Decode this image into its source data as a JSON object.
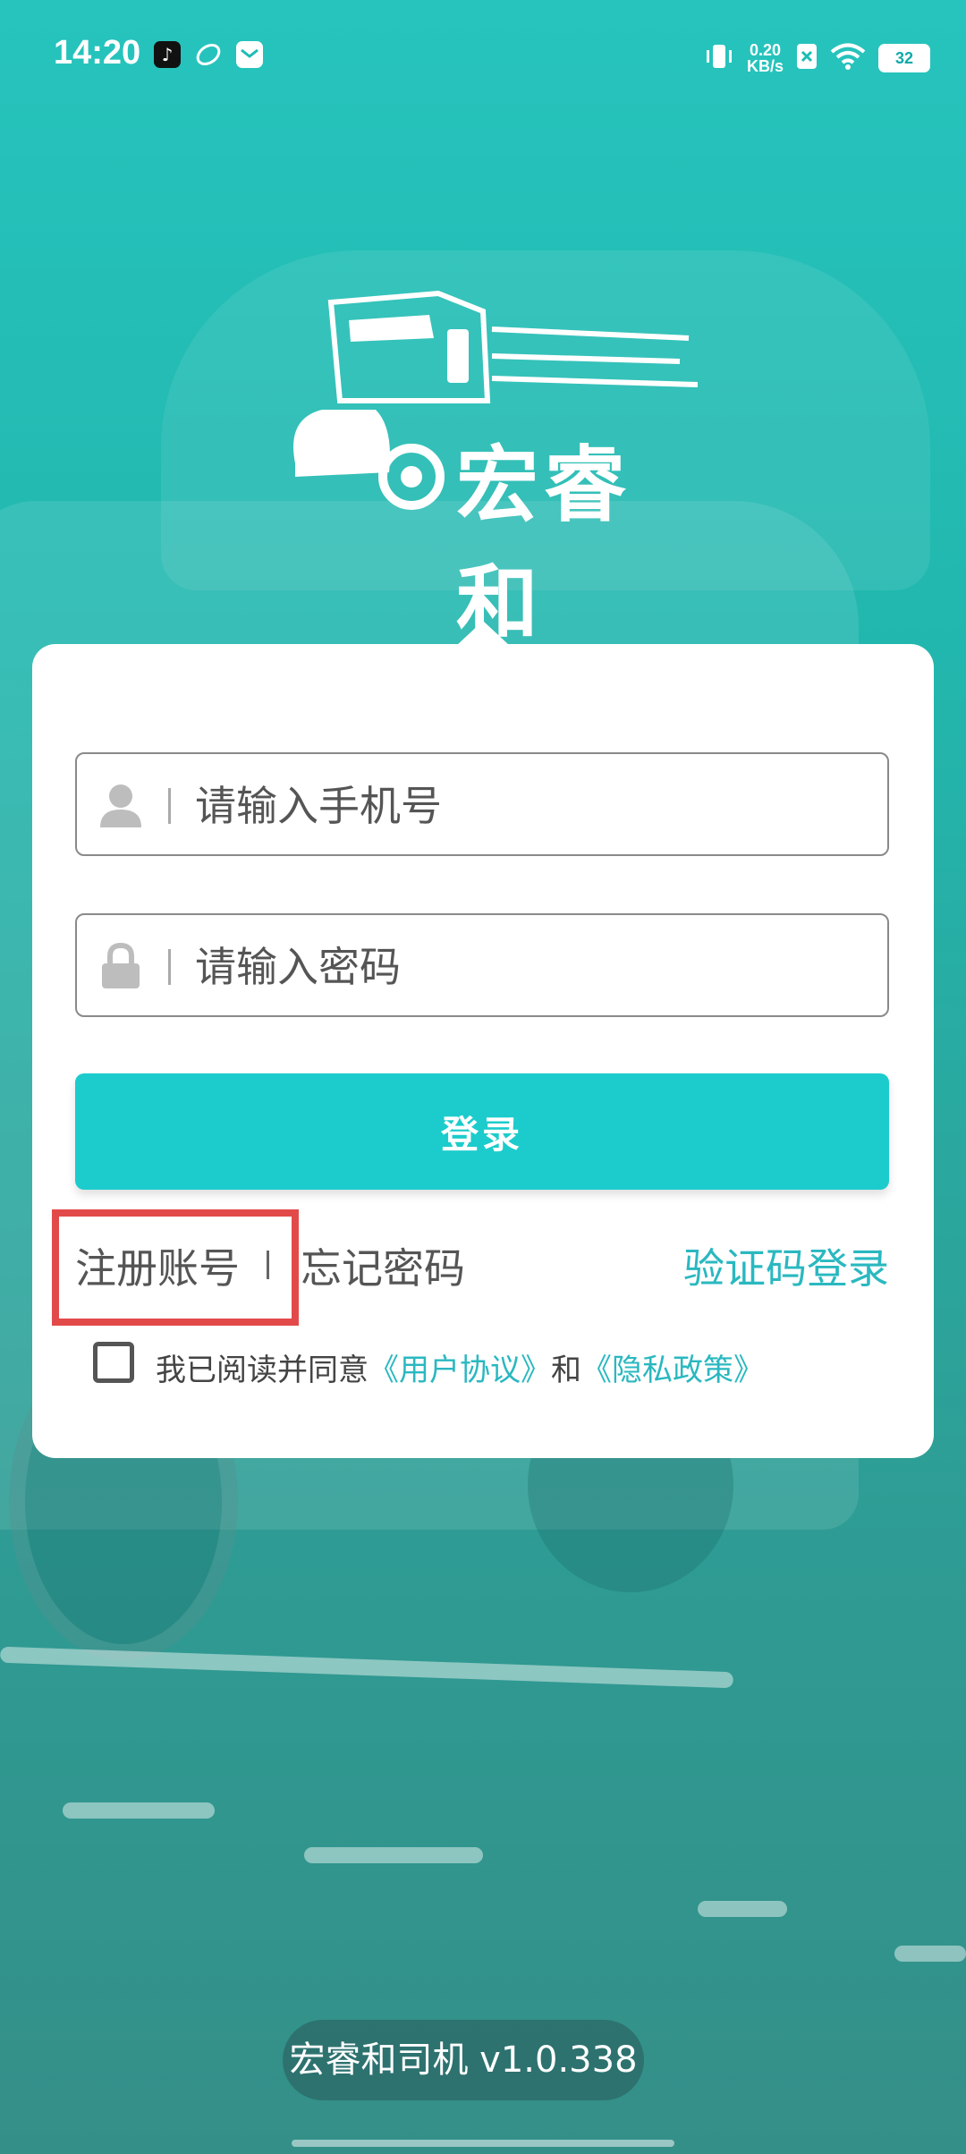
{
  "status_bar": {
    "time": "14:20",
    "net_speed_value": "0.20",
    "net_speed_unit": "KB/s",
    "battery": "32",
    "app_icons": [
      "tiktok-icon",
      "leaf-app-icon",
      "mail-app-icon"
    ]
  },
  "brand": {
    "name": "宏睿和"
  },
  "login_form": {
    "phone_placeholder": "请输入手机号",
    "password_placeholder": "请输入密码",
    "login_button": "登录",
    "register_link": "注册账号",
    "forgot_link": "忘记密码",
    "sms_login_link": "验证码登录",
    "agreement_prefix": "我已阅读并同意",
    "user_agreement": "《用户协议》",
    "agreement_and": "和",
    "privacy_policy": "《隐私政策》"
  },
  "footer": {
    "version": "宏睿和司机 v1.0.338"
  },
  "colors": {
    "accent": "#1ccccc",
    "link": "#2ab8c0",
    "highlight": "#e24a4a",
    "background": "#26c4bd"
  }
}
